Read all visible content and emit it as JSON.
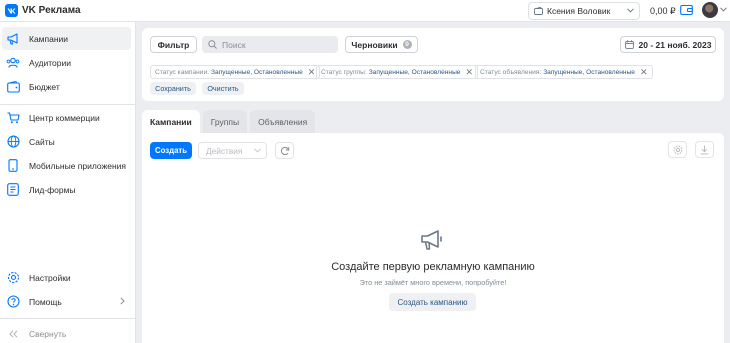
{
  "app": {
    "logo_text": "VK Реклама"
  },
  "header": {
    "account_name": "Ксения Воловик",
    "balance": "0,00 ₽"
  },
  "sidebar": {
    "items": [
      {
        "label": "Кампании",
        "icon": "megaphone-icon",
        "active": true
      },
      {
        "label": "Аудитории",
        "icon": "users-icon"
      },
      {
        "label": "Бюджет",
        "icon": "wallet-icon"
      },
      {
        "label": "Центр коммерции",
        "icon": "cart-icon"
      },
      {
        "label": "Сайты",
        "icon": "globe-icon"
      },
      {
        "label": "Мобильные приложения",
        "icon": "phone-icon"
      },
      {
        "label": "Лид-формы",
        "icon": "form-icon"
      }
    ],
    "bottom": [
      {
        "label": "Настройки",
        "icon": "gear-icon"
      },
      {
        "label": "Помощь",
        "icon": "help-icon"
      }
    ],
    "collapse_label": "Свернуть"
  },
  "filters": {
    "filter_label": "Фильтр",
    "search_placeholder": "Поиск",
    "drafts_label": "Черновики",
    "drafts_count": "0",
    "date_range": "20 - 21 нояб. 2023",
    "chips": [
      {
        "key": "Статус кампании:",
        "value": "Запущенные, Остановленные"
      },
      {
        "key": "Статус группы:",
        "value": "Запущенные, Остановленные"
      },
      {
        "key": "Статус объявления:",
        "value": "Запущенные, Остановленные"
      }
    ],
    "save_label": "Сохранить",
    "clear_label": "Очистить"
  },
  "tabs": [
    "Кампании",
    "Группы",
    "Объявления"
  ],
  "toolbar": {
    "create_label": "Создать",
    "actions_placeholder": "Действия"
  },
  "empty_state": {
    "title": "Создайте первую рекламную кампанию",
    "subtitle": "Это не займёт много времени, попробуйте!",
    "button_label": "Создать кампанию"
  },
  "colors": {
    "accent": "#0077ff",
    "link": "#2a5885",
    "background": "#ebedf0"
  }
}
